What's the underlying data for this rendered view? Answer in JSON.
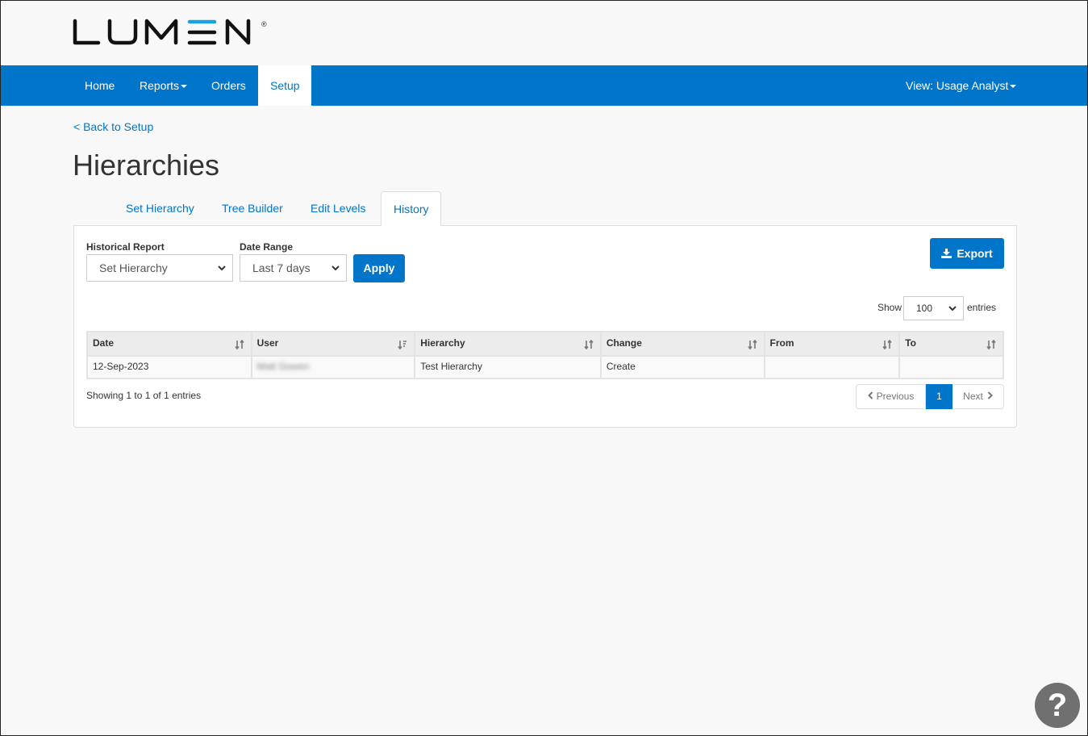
{
  "brand": {
    "name": "LUMEN",
    "registered_mark": "®",
    "accent_color": "#0075c9"
  },
  "nav": {
    "items": [
      {
        "label": "Home",
        "has_dropdown": false,
        "active": false
      },
      {
        "label": "Reports",
        "has_dropdown": true,
        "active": false
      },
      {
        "label": "Orders",
        "has_dropdown": false,
        "active": false
      },
      {
        "label": "Setup",
        "has_dropdown": false,
        "active": true
      }
    ],
    "view_label": "View: Usage Analyst"
  },
  "breadcrumb": {
    "back_label": "< Back to Setup"
  },
  "page": {
    "title": "Hierarchies"
  },
  "tabs": [
    {
      "label": "Set Hierarchy",
      "active": false
    },
    {
      "label": "Tree Builder",
      "active": false
    },
    {
      "label": "Edit Levels",
      "active": false
    },
    {
      "label": "History",
      "active": true
    }
  ],
  "filters": {
    "historical_report": {
      "label": "Historical Report",
      "value": "Set Hierarchy"
    },
    "date_range": {
      "label": "Date Range",
      "value": "Last 7 days"
    },
    "apply_label": "Apply",
    "export_label": "Export"
  },
  "table_controls": {
    "show_label": "Show",
    "page_size": "100",
    "entries_label": "entries"
  },
  "table": {
    "columns": [
      "Date",
      "User",
      "Hierarchy",
      "Change",
      "From",
      "To"
    ],
    "rows": [
      {
        "date": "12-Sep-2023",
        "user": "Matt Gowen",
        "hierarchy": "Test Hierarchy",
        "change": "Create",
        "from": "",
        "to": ""
      }
    ]
  },
  "footer": {
    "showing_text": "Showing 1 to 1 of 1 entries",
    "previous_label": "Previous",
    "current_page": "1",
    "next_label": "Next"
  },
  "help": {
    "label": "?"
  }
}
